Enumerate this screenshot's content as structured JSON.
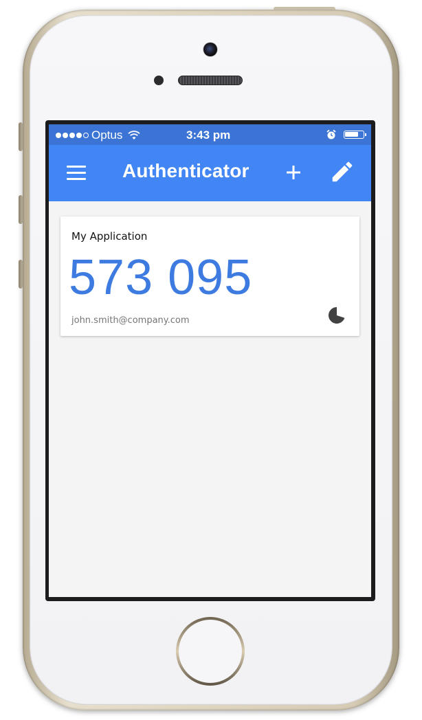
{
  "status_bar": {
    "carrier": "Optus",
    "signal_bars": 4,
    "signal_total": 5,
    "time": "3:43 pm",
    "battery_level": 0.8,
    "icons": [
      "wifi-icon",
      "alarm-icon",
      "battery-icon"
    ]
  },
  "toolbar": {
    "title": "Authenticator",
    "background_color": "#4285f4",
    "icons": [
      "menu-icon",
      "add-icon",
      "edit-icon"
    ]
  },
  "accounts": [
    {
      "issuer": "My Application",
      "code": "573 095",
      "account": "john.smith@company.com",
      "time_remaining_fraction": 0.3
    }
  ],
  "colors": {
    "accent": "#4285f4",
    "code": "#3e7be0",
    "status_bar": "#3b74d4",
    "screen_background": "#f4f4f5"
  }
}
